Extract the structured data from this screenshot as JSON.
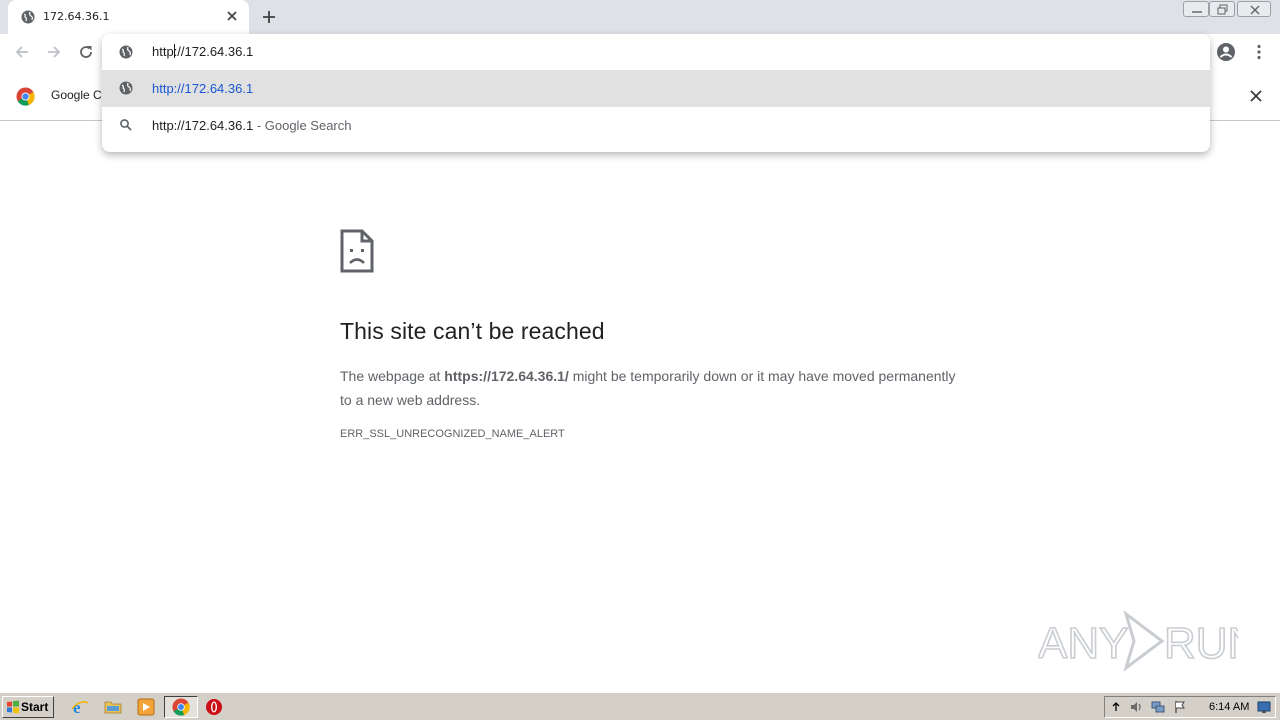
{
  "tab": {
    "title": "172.64.36.1",
    "favicon_icon": "globe-icon",
    "close_icon": "close-icon"
  },
  "toolbar": {
    "back_icon": "arrow-left-icon",
    "forward_icon": "arrow-right-icon",
    "reload_icon": "reload-icon",
    "profile_icon": "account-circle-icon",
    "menu_icon": "kebab-menu-icon"
  },
  "omnibox": {
    "input_before_caret": "http",
    "input_after_caret": "://172.64.36.1",
    "suggestions": [
      {
        "icon": "globe-icon",
        "text": "http://172.64.36.1",
        "suffix": "",
        "selected": true
      },
      {
        "icon": "search-icon",
        "text": "http://172.64.36.1",
        "suffix": " - Google Search",
        "selected": false
      }
    ]
  },
  "infobar": {
    "text": "Google Cl"
  },
  "error_page": {
    "heading": "This site can’t be reached",
    "body_prefix": "The webpage at ",
    "body_url": "https://172.64.36.1/",
    "body_suffix": " might be temporarily down or it may have moved permanently to a new web address.",
    "error_code": "ERR_SSL_UNRECOGNIZED_NAME_ALERT"
  },
  "watermark": {
    "text": "ANY RUN"
  },
  "taskbar": {
    "start_label": "Start",
    "apps": [
      "ie-icon",
      "folder-icon",
      "media-player-icon",
      "chrome-icon",
      "opera-icon"
    ],
    "tray_icons": [
      "show-hidden-icon",
      "speaker-icon",
      "network-icon",
      "flag-icon",
      "desktop-icon"
    ],
    "clock": "6:14 AM"
  },
  "colors": {
    "tabstrip": "#dee1e6",
    "link_blue": "#1a57d0",
    "text": "#202124",
    "muted": "#5f6368",
    "taskbar": "#d4d0c8"
  }
}
